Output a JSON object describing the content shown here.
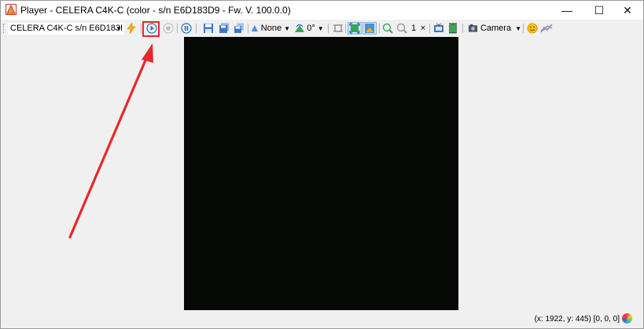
{
  "window": {
    "title": "Player - CELERA C4K-C (color - s/n E6D183D9 - Fw. V. 100.0.0)",
    "minimize_glyph": "—",
    "maximize_glyph": "☐",
    "close_glyph": "✕"
  },
  "toolbar": {
    "camera_select": "CELERA C4K-C s/n E6D183I",
    "filter_select": "None",
    "rotation_select": "0°",
    "zoom_value": "1",
    "zoom_reset_label": "×",
    "source_select": "Camera"
  },
  "status": {
    "text": "(x: 1922, y: 445) [0, 0, 0]"
  },
  "colors": {
    "highlight": "#e8282b",
    "video_bg": "#060806",
    "toggle_bg": "#cfe6fb"
  }
}
